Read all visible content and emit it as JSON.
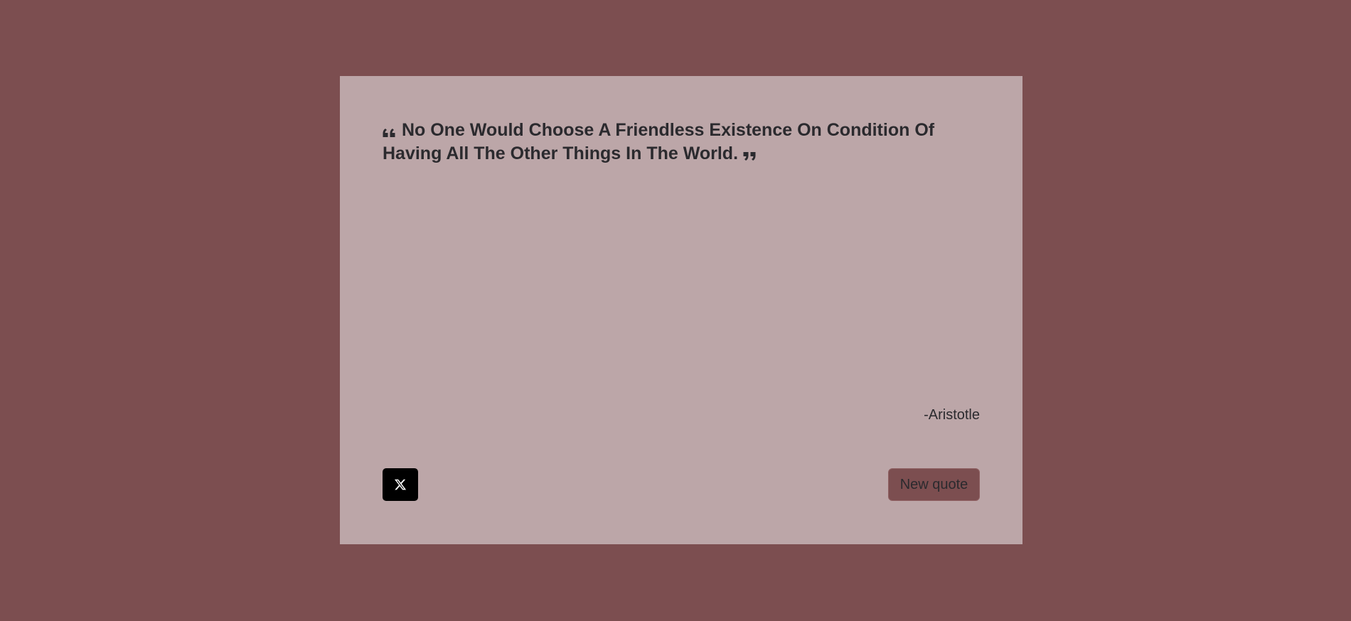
{
  "theme": {
    "background_color": "#7c4e50",
    "card_color": "#bca6a8",
    "text_color": "#2b2a2e",
    "button_color": "#7c4e50",
    "tweet_button_color": "#000000"
  },
  "quote": {
    "text": "No One Would Choose A Friendless Existence On Condition Of Having All The Other Things In The World.",
    "open_icon": "quote-left-icon",
    "close_icon": "quote-right-icon"
  },
  "author": {
    "name": "-Aristotle"
  },
  "actions": {
    "tweet_icon": "x-twitter-icon",
    "new_quote_label": "New quote"
  }
}
